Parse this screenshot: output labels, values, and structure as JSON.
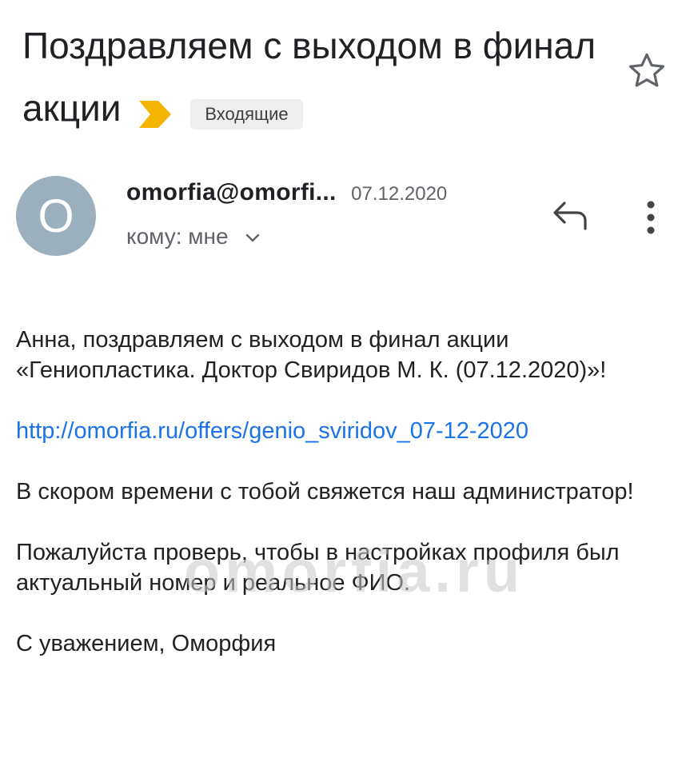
{
  "email": {
    "subject": "Поздравляем с выходом в финал акции",
    "folder_badge": "Входящие",
    "sender": "omorfia@omorfi...",
    "date": "07.12.2020",
    "avatar_letter": "O",
    "recipient": "кому: мне",
    "body": {
      "greeting": "Анна, поздравляем с выходом в финал акции «Гениопластика. Доктор Свиридов М. К. (07.12.2020)»!",
      "link": "http://omorfia.ru/offers/genio_sviridov_07-12-2020",
      "contact_note": "В скором времени с тобой свяжется наш администратор!",
      "profile_note": "Пожалуйста проверь, чтобы в настройках профиля был актуальный номер и реальное ФИО.",
      "signature": "С уважением, Оморфия"
    },
    "watermark": "omorfia.ru"
  },
  "colors": {
    "avatar_bg": "#9bb0bc",
    "importance_marker": "#f4b400",
    "link": "#1a73e8",
    "badge_bg": "#eeeeee"
  },
  "icons": [
    "importance-marker-icon",
    "star-icon",
    "chevron-down-icon",
    "reply-icon",
    "more-vert-icon"
  ]
}
